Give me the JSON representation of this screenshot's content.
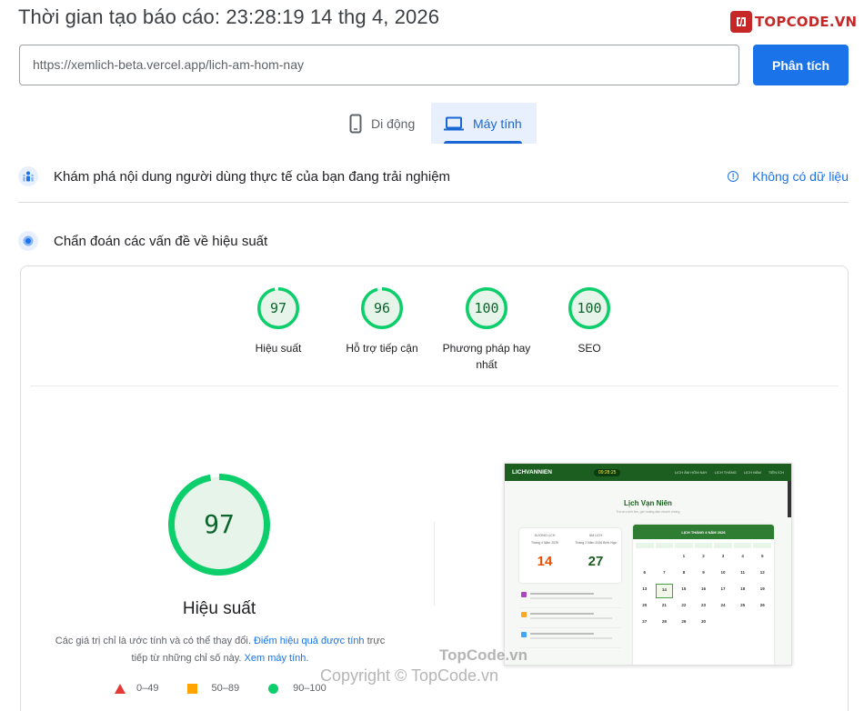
{
  "header": {
    "title": "Thời gian tạo báo cáo: 23:28:19 14 thg 4, 2026",
    "logo_text": "TOPCODE.VN"
  },
  "search": {
    "url": "https://xemlich-beta.vercel.app/lich-am-hom-nay",
    "analyze_label": "Phân tích"
  },
  "tabs": [
    {
      "label": "Di động",
      "icon": "phone-icon",
      "active": false
    },
    {
      "label": "Máy tính",
      "icon": "laptop-icon",
      "active": true
    }
  ],
  "field_data": {
    "text": "Khám phá nội dung người dùng thực tế của bạn đang trải nghiệm",
    "status": "Không có dữ liệu"
  },
  "diagnostics": {
    "text": "Chẩn đoán các vấn đề về hiệu suất"
  },
  "scores": [
    {
      "value": "97",
      "label": "Hiệu suất",
      "fraction": 0.97
    },
    {
      "value": "96",
      "label": "Hỗ trợ tiếp cận",
      "fraction": 0.96
    },
    {
      "value": "100",
      "label": "Phương pháp hay nhất",
      "fraction": 1.0
    },
    {
      "value": "100",
      "label": "SEO",
      "fraction": 1.0
    }
  ],
  "main_score": {
    "value": "97",
    "label": "Hiệu suất",
    "fraction": 0.97,
    "note_prefix": "Các giá trị chỉ là ước tính và có thể thay đổi.",
    "note_link1": "Điểm hiệu quả được tính",
    "note_mid": "trực tiếp từ những chỉ số này.",
    "note_link2": "Xem máy tính."
  },
  "legend": [
    {
      "range": "0–49",
      "shape": "triangle",
      "color": "#e53935"
    },
    {
      "range": "50–89",
      "shape": "square",
      "color": "#ffa400"
    },
    {
      "range": "90–100",
      "shape": "circle",
      "color": "#0cce6b"
    }
  ],
  "thumbnail": {
    "brand": "LICHVANNIEN",
    "clock": "09:28:25",
    "links": [
      "LỊCH ÂM HÔM NAY",
      "LỊCH THÁNG",
      "LỊCH NĂM",
      "TIỆN ÍCH"
    ],
    "title": "Lịch Vạn Niên",
    "subtitle": "Tra cứu lịch âm, giờ hoàng đạo nhanh chóng",
    "solar_label": "DƯƠNG LỊCH",
    "lunar_label": "ÂM LỊCH",
    "solar_month": "Tháng 4 Năm 2026",
    "lunar_month": "Tháng 2 Năm 2026 Bính Ngọ",
    "solar_day": "14",
    "lunar_day": "27",
    "calendar_title": "LỊCH THÁNG 4 NĂM 2026",
    "days": [
      "",
      "",
      "1",
      "2",
      "3",
      "4",
      "5",
      "6",
      "7",
      "8",
      "9",
      "10",
      "11",
      "12",
      "13",
      "14",
      "15",
      "16",
      "17",
      "18",
      "19",
      "20",
      "21",
      "22",
      "23",
      "24",
      "25",
      "26",
      "27",
      "28",
      "29",
      "30",
      "",
      "",
      ""
    ]
  },
  "watermark": {
    "line1": "TopCode.vn",
    "line2": "Copyright © TopCode.vn"
  },
  "colors": {
    "accent": "#1a73e8",
    "pass_green": "#0cce6b",
    "pass_text": "#0d652d",
    "pass_fill": "#e6f4ea"
  }
}
